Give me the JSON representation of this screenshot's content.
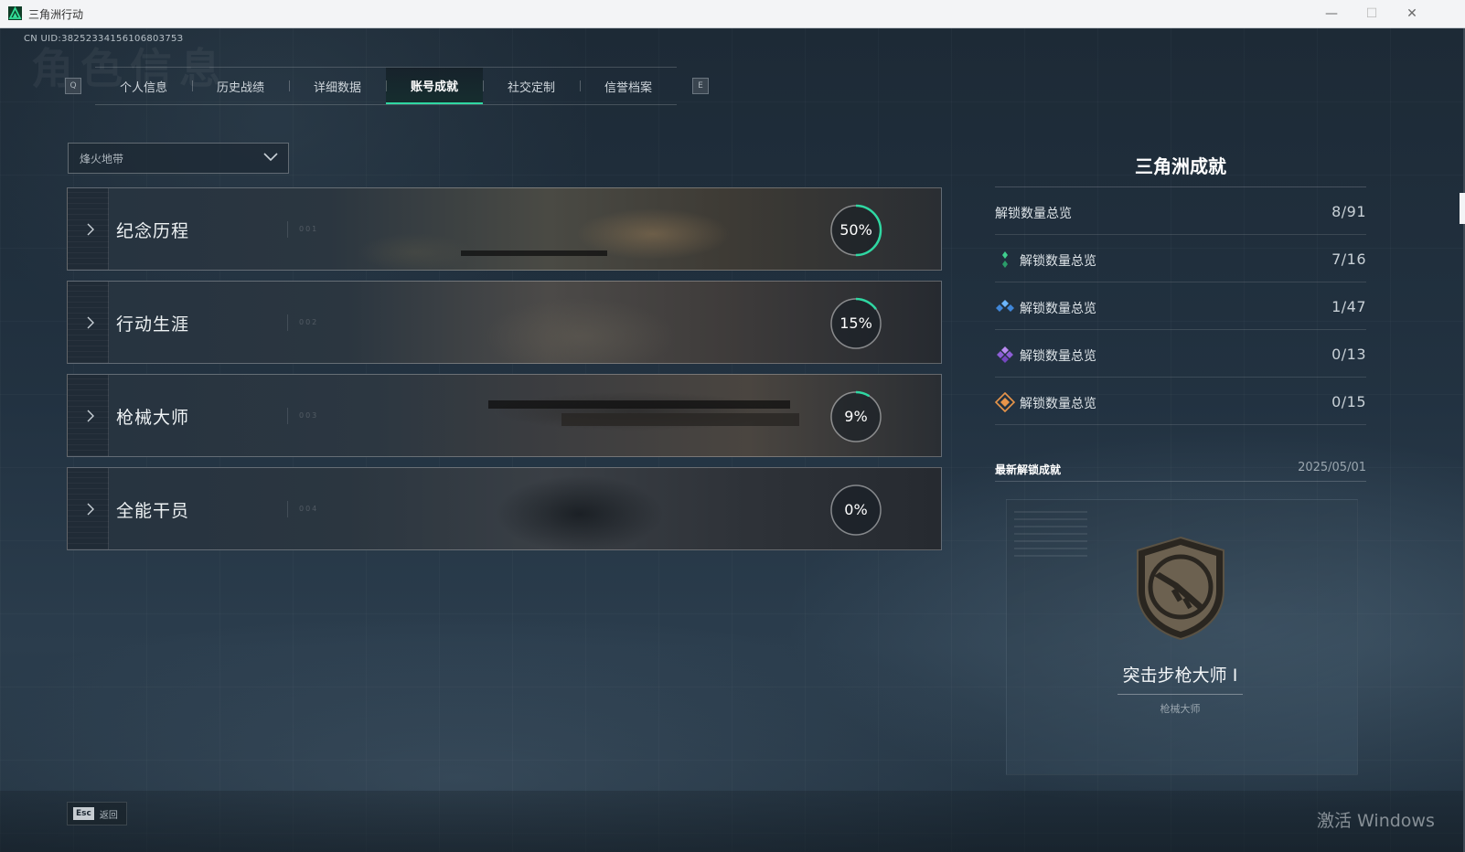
{
  "window": {
    "title": "三角洲行动",
    "minimize": "—",
    "maximize": "☐",
    "close": "✕"
  },
  "header": {
    "uid": "CN UID:3825233415610680375З",
    "bg_title": "角色信息"
  },
  "tabs": {
    "prev_key": "Q",
    "next_key": "E",
    "items": [
      {
        "label": "个人信息"
      },
      {
        "label": "历史战绩"
      },
      {
        "label": "详细数据"
      },
      {
        "label": "账号成就"
      },
      {
        "label": "社交定制"
      },
      {
        "label": "信誉档案"
      }
    ],
    "active_index": 3
  },
  "mode_select": {
    "value": "烽火地带"
  },
  "categories": [
    {
      "name": "纪念历程",
      "percent": 50,
      "percent_label": "50%",
      "code": "001"
    },
    {
      "name": "行动生涯",
      "percent": 15,
      "percent_label": "15%",
      "code": "002"
    },
    {
      "name": "枪械大师",
      "percent": 9,
      "percent_label": "9%",
      "code": "003"
    },
    {
      "name": "全能干员",
      "percent": 0,
      "percent_label": "0%",
      "code": "004"
    }
  ],
  "panel": {
    "title": "三角洲成就",
    "total": {
      "label": "解锁数量总览",
      "count": "8/91"
    },
    "tiers": [
      {
        "label": "解锁数量总览",
        "count": "7/16",
        "icon": "green-gem-icon",
        "color": "#3fcf8e"
      },
      {
        "label": "解锁数量总览",
        "count": "1/47",
        "icon": "blue-gem-icon",
        "color": "#4d9de8"
      },
      {
        "label": "解锁数量总览",
        "count": "0/13",
        "icon": "purple-gem-icon",
        "color": "#a070e0"
      },
      {
        "label": "解锁数量总览",
        "count": "0/15",
        "icon": "orange-gem-icon",
        "color": "#e8954a"
      }
    ],
    "latest": {
      "label": "最新解锁成就",
      "date": "2025/05/01",
      "name": "突击步枪大师 Ⅰ",
      "category": "枪械大师",
      "icon": "rifle-badge-icon"
    }
  },
  "footer": {
    "esc_key": "Esc",
    "esc_label": "返回",
    "watermark": "激活 Windows"
  },
  "colors": {
    "accent": "#2fd7a2",
    "background": "#1b2631"
  }
}
